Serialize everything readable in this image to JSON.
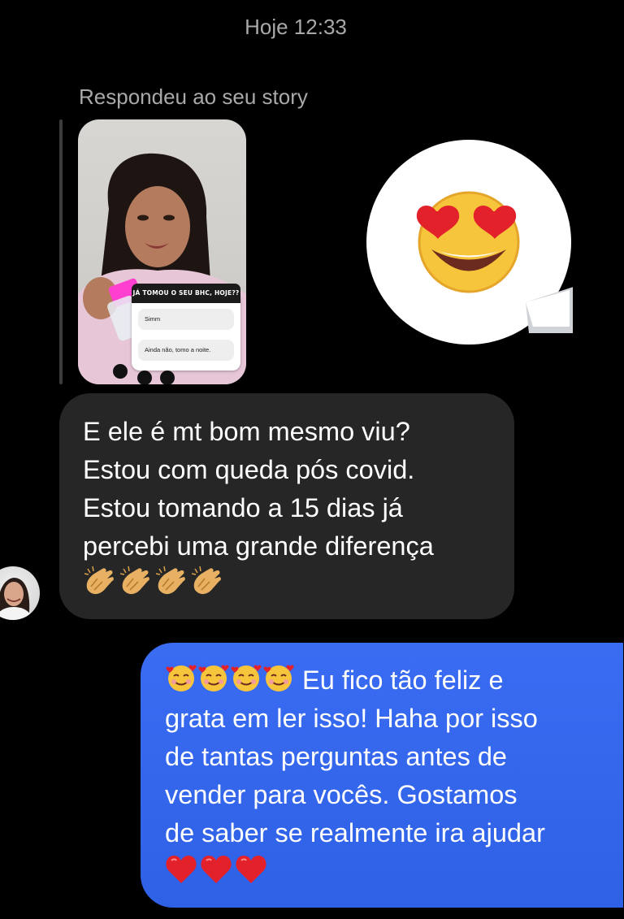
{
  "header": {
    "timestamp": "Hoje 12:33"
  },
  "story_reply": {
    "label": "Respondeu ao seu story",
    "poll": {
      "question": "JÁ TOMOU O SEU BHC, HOJE??",
      "options": [
        "Simm",
        "Ainda não,  tomo a noite."
      ]
    },
    "reaction_emoji": "smiling-face-with-heart-eyes"
  },
  "messages": [
    {
      "direction": "incoming",
      "lines": [
        "E ele é mt bom mesmo viu?",
        "Estou com queda pós covid.",
        "Estou tomando a 15 dias já",
        "percebi uma grande diferença"
      ],
      "trailing_emoji": [
        "clapping-hands",
        "clapping-hands",
        "clapping-hands",
        "clapping-hands"
      ]
    },
    {
      "direction": "outgoing",
      "leading_emoji": [
        "smiling-face-with-hearts",
        "smiling-face-with-hearts",
        "smiling-face-with-hearts",
        "smiling-face-with-hearts"
      ],
      "lines": [
        "Eu fico tão feliz e",
        "grata em ler isso! Haha por isso",
        "de tantas perguntas antes de",
        "vender para vocês.  Gostamos",
        "de saber se realmente ira ajudar"
      ],
      "trailing_emoji": [
        "red-heart",
        "red-heart",
        "red-heart"
      ]
    }
  ],
  "colors": {
    "background": "#000000",
    "incoming_bubble": "#262626",
    "outgoing_bubble": "#3a6cf3",
    "meta_text": "#a9a9a9"
  }
}
